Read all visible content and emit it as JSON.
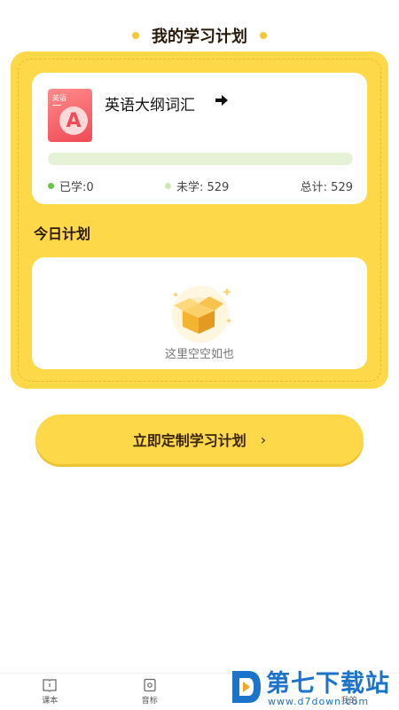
{
  "header": {
    "title": "我的学习计划"
  },
  "book": {
    "cover_label": "英语",
    "cover_letter": "A",
    "name": "英语大纲词汇",
    "progress_fraction": 0.0,
    "learned_label": "已学:0",
    "unlearned_label": "未学: 529",
    "total_label": "总计: 529"
  },
  "today": {
    "title": "今日计划",
    "empty_text": "这里空空如也"
  },
  "cta": {
    "label": "立即定制学习计划",
    "chevron": "›"
  },
  "tabbar": {
    "items": [
      {
        "label": "课本",
        "icon": "book-icon"
      },
      {
        "label": "音标",
        "icon": "phonetic-icon"
      },
      {
        "label": "",
        "icon": "plan-icon"
      },
      {
        "label": "我的",
        "icon": "profile-icon"
      }
    ]
  },
  "watermark": {
    "text": "第七下载站",
    "url": "www.d7down.com"
  },
  "colors": {
    "accent": "#fdd94a",
    "progress_track": "#e6f2d6",
    "learned_dot": "#6cc24a",
    "watermark": "#1b74c9"
  }
}
